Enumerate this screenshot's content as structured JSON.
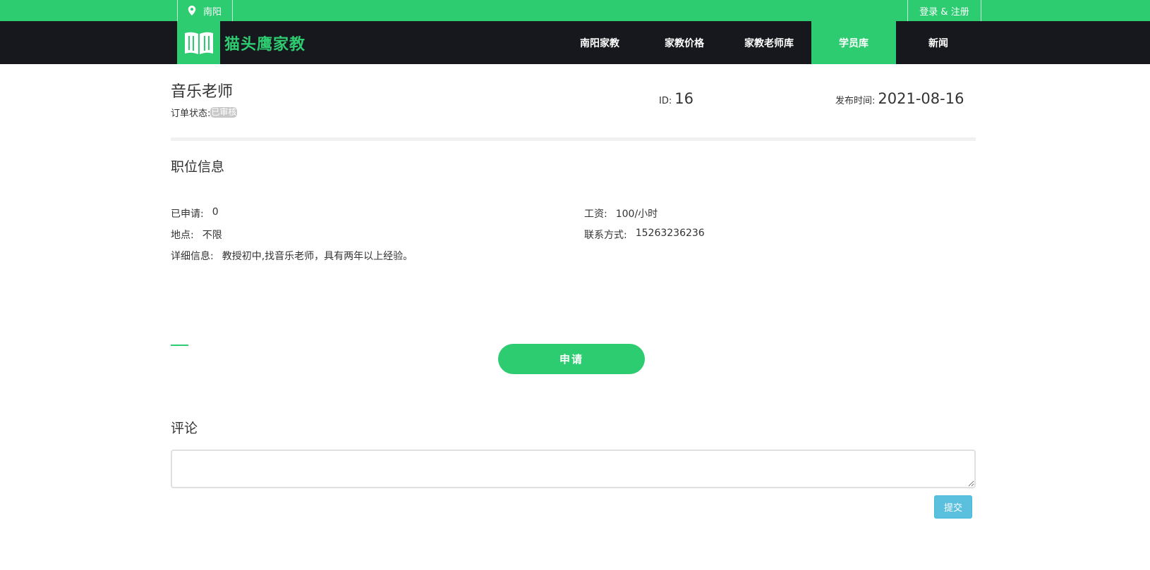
{
  "topbar": {
    "city": "南阳",
    "city_icon": "map-pin-icon",
    "login": "登录 & 注册"
  },
  "navbar": {
    "logo_icon": "open-book-icon",
    "logo_text": "猫头鹰家教",
    "items": [
      {
        "label": "南阳家教"
      },
      {
        "label": "家教价格"
      },
      {
        "label": "家教老师库"
      },
      {
        "label": "学员库"
      },
      {
        "label": "新闻"
      }
    ],
    "active": "学员库"
  },
  "job": {
    "title": "音乐老师",
    "status_label": "订单状态:",
    "status_value": "已审核",
    "id_label": "ID:",
    "id_value": "16",
    "date_label": "发布时间:",
    "date_value": "2021-08-16"
  },
  "position_info": {
    "section_title": "职位信息",
    "applied_label": "已申请:",
    "applied_value": "0",
    "salary_label": "工资:",
    "salary_value": "100/小时",
    "location_label": "地点:",
    "location_value": "不限",
    "contact_label": "联系方式:",
    "contact_value": "15263236236",
    "detail_label": "详细信息:",
    "detail_value": "教授初中,找音乐老师，具有两年以上经验。"
  },
  "apply_button": "申请",
  "comments": {
    "section_title": "评论",
    "input_value": "",
    "submit_label": "提交"
  },
  "colors": {
    "brand_green": "#2ecc71",
    "nav_dark": "#16181d",
    "submit_blue": "#5bc0de"
  }
}
